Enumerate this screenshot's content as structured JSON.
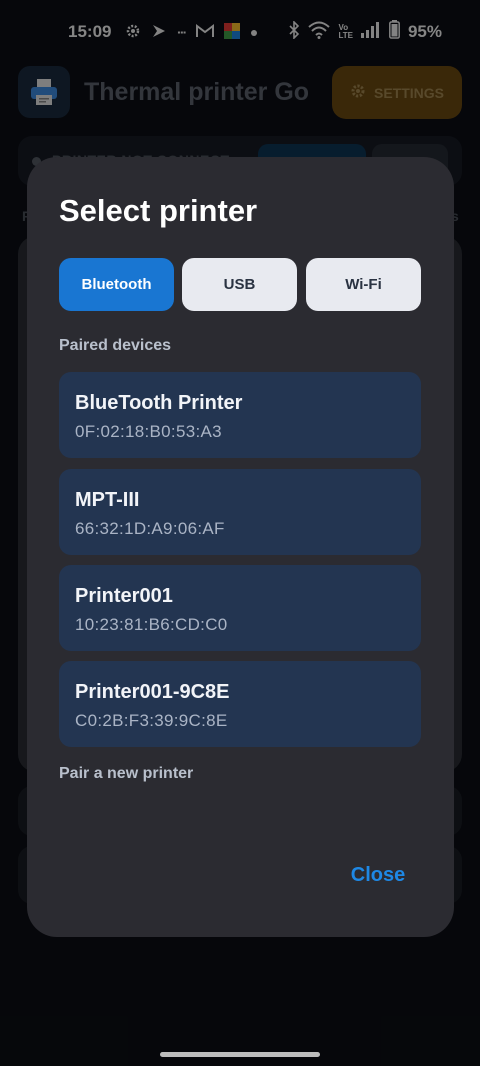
{
  "status_bar": {
    "time": "15:09",
    "battery": "95%",
    "left_icons": [
      "gear-icon",
      "play-icon",
      "small-text-icon",
      "gmail-icon",
      "photos-icon",
      "dot-icon"
    ],
    "right_icons": [
      "bluetooth-icon",
      "wifi-icon",
      "volte-icon",
      "signal-icon",
      "battery-icon"
    ]
  },
  "background_app": {
    "title": "Thermal printer Go",
    "settings_label": "SETTINGS",
    "status_text": "PRINTER NOT CONNECT",
    "side_left": "P",
    "side_right": "s"
  },
  "dialog": {
    "title": "Select printer",
    "tabs": [
      {
        "label": "Bluetooth",
        "active": true
      },
      {
        "label": "USB",
        "active": false
      },
      {
        "label": "Wi-Fi",
        "active": false
      }
    ],
    "paired_label": "Paired devices",
    "devices": [
      {
        "name": "BlueTooth Printer",
        "mac": "0F:02:18:B0:53:A3"
      },
      {
        "name": "MPT-III",
        "mac": "66:32:1D:A9:06:AF"
      },
      {
        "name": "Printer001",
        "mac": "10:23:81:B6:CD:C0"
      },
      {
        "name": "Printer001-9C8E",
        "mac": "C0:2B:F3:39:9C:8E"
      }
    ],
    "pair_new_label": "Pair a new printer",
    "close_label": "Close"
  },
  "colors": {
    "accent": "#1976d2",
    "device_card": "#233551",
    "dialog_bg": "#2b2b31",
    "settings_btn": "#6b4a12"
  }
}
